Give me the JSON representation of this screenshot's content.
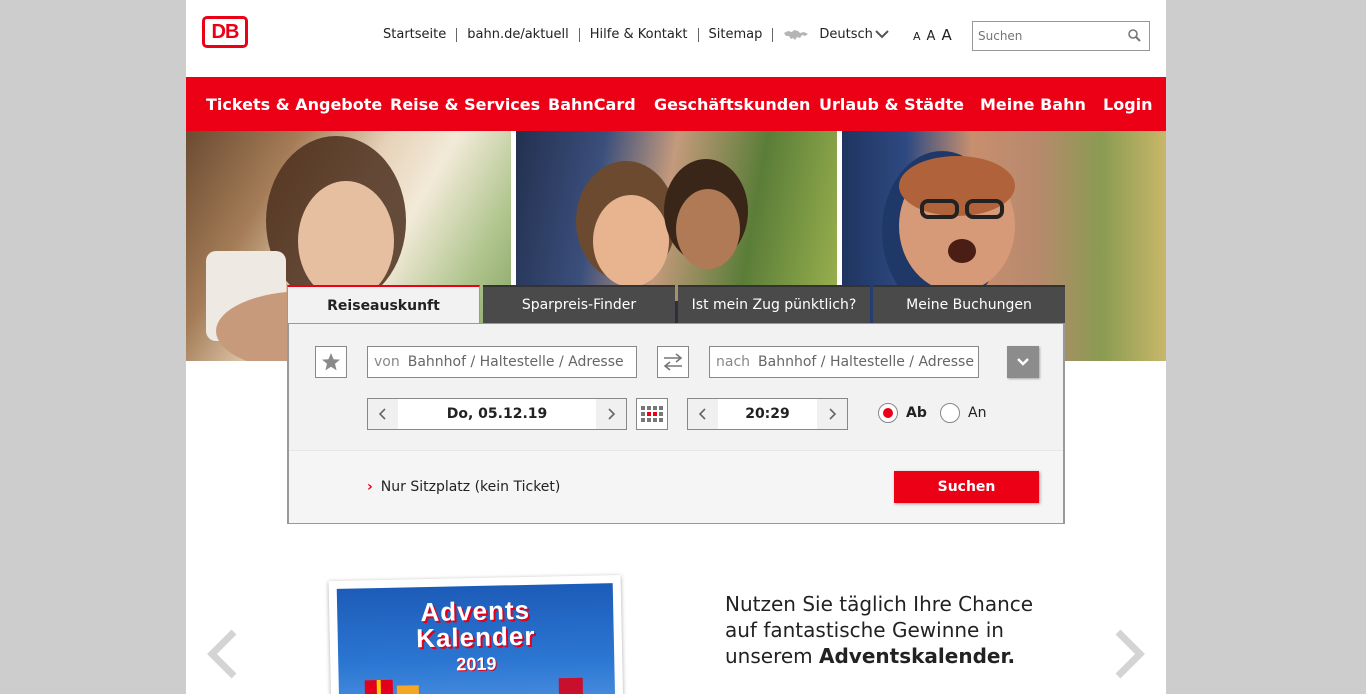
{
  "header": {
    "logo_text": "DB",
    "links": [
      "Startseite",
      "bahn.de/aktuell",
      "Hilfe & Kontakt",
      "Sitemap"
    ],
    "language": "Deutsch",
    "font_sizes": [
      "A",
      "A",
      "A"
    ],
    "search_placeholder": "Suchen"
  },
  "mainnav": {
    "items": [
      "Tickets & Angebote",
      "Reise & Services",
      "BahnCard",
      "Geschäftskunden",
      "Urlaub & Städte",
      "Meine Bahn",
      "Login"
    ]
  },
  "booking": {
    "tabs": [
      "Reiseauskunft",
      "Sparpreis-Finder",
      "Ist mein Zug pünktlich?",
      "Meine Buchungen"
    ],
    "active_tab": "Reiseauskunft",
    "from_label": "von",
    "to_label": "nach",
    "station_placeholder": "Bahnhof / Haltestelle / Adresse",
    "date": "Do, 05.12.19",
    "time": "20:29",
    "radio_dep": "Ab",
    "radio_arr": "An",
    "selected": "Ab",
    "seat_only_link": "Nur Sitzplatz (kein Ticket)",
    "search_button": "Suchen"
  },
  "promo": {
    "advent_title_1": "Advents",
    "advent_title_2": "Kalender",
    "advent_year": "2019",
    "text_pre": "Nutzen Sie täglich Ihre Chance auf fantastische Gewinne in unserem ",
    "text_bold": "Adventskalender."
  },
  "colors": {
    "brand_red": "#ec0016",
    "tab_dark": "#4a4a4a",
    "panel_bg": "#f2f2f2"
  }
}
